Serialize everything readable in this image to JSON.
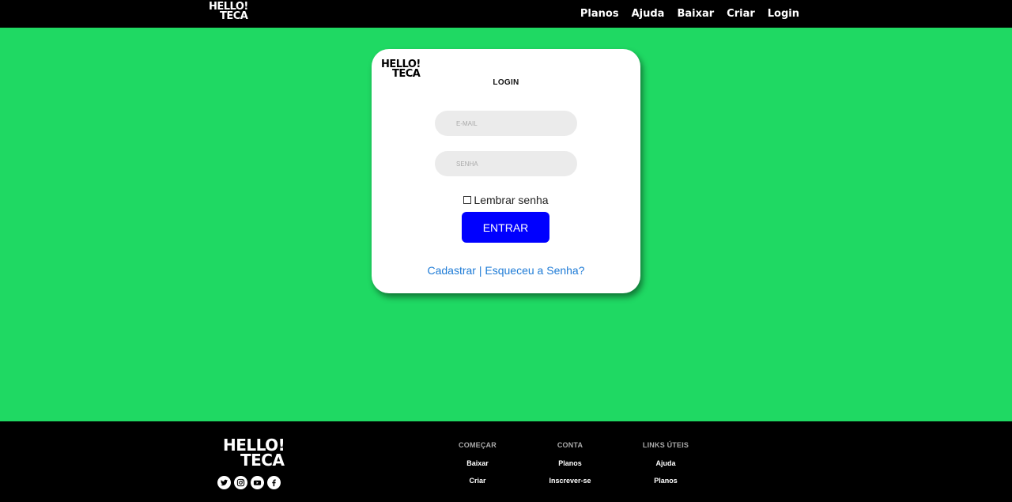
{
  "brand": {
    "line1": "HELLO!",
    "line2": "TECA"
  },
  "nav": {
    "items": [
      {
        "label": "Planos"
      },
      {
        "label": "Ajuda"
      },
      {
        "label": "Baixar"
      },
      {
        "label": "Criar"
      },
      {
        "label": "Login"
      }
    ]
  },
  "login": {
    "title": "LOGIN",
    "email_placeholder": "E-MAIL",
    "email_value": "",
    "password_placeholder": "SENHA",
    "password_value": "",
    "remember_label": "Lembrar senha",
    "remember_checked": false,
    "submit_label": "ENTRAR",
    "register_link": "Cadastrar",
    "separator": "|",
    "forgot_link": "Esqueceu a Senha?"
  },
  "footer": {
    "columns": [
      {
        "heading": "COMEÇAR",
        "links": [
          "Baixar",
          "Criar"
        ]
      },
      {
        "heading": "CONTA",
        "links": [
          "Planos",
          "Inscrever-se"
        ]
      },
      {
        "heading": "LINKS ÚTEIS",
        "links": [
          "Ajuda",
          "Planos"
        ]
      }
    ],
    "socials": [
      "twitter-icon",
      "instagram-icon",
      "youtube-icon",
      "facebook-icon"
    ]
  },
  "colors": {
    "background": "#1fd963",
    "bar": "#000000",
    "button": "#0000ff",
    "link": "#1e7bd6"
  }
}
